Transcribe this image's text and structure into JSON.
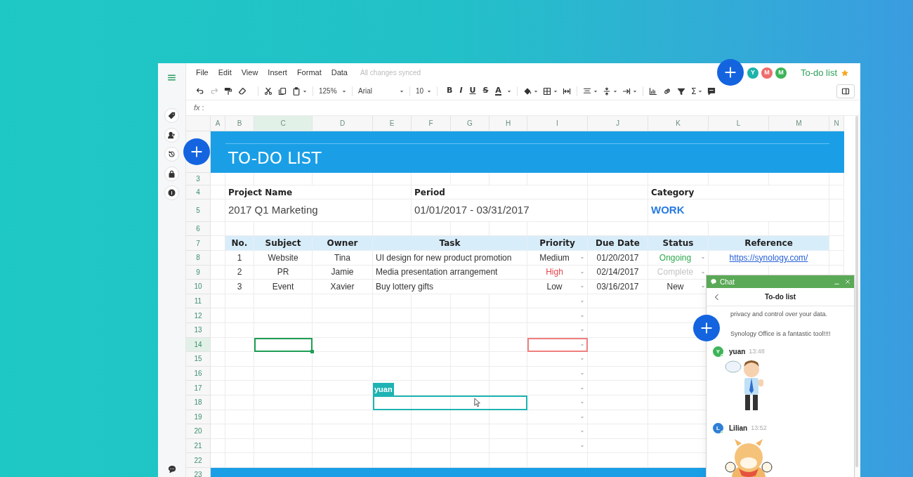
{
  "menu": [
    "File",
    "Edit",
    "View",
    "Insert",
    "Format",
    "Data"
  ],
  "sync_status": "All changes synced",
  "collaborators": [
    {
      "initial": "Y",
      "color": "#1db3aa"
    },
    {
      "initial": "M",
      "color": "#ef6c6c"
    },
    {
      "initial": "M",
      "color": "#3db45a"
    }
  ],
  "document": {
    "title": "To-do list",
    "starred": true
  },
  "toolbar": {
    "zoom": "125%",
    "font": "Arial",
    "font_size": "10",
    "text_styles": [
      {
        "glyph": "B",
        "kind": "bold"
      },
      {
        "glyph": "I",
        "kind": "italic"
      },
      {
        "glyph": "U",
        "kind": "underline"
      },
      {
        "glyph": "S",
        "kind": "strike"
      },
      {
        "glyph": "A",
        "kind": "color"
      }
    ],
    "sum": "Σ"
  },
  "formula_bar": {
    "label": "*fx* :"
  },
  "columns": [
    {
      "label": "A",
      "selected": false
    },
    {
      "label": "B",
      "selected": false
    },
    {
      "label": "C",
      "selected": true
    },
    {
      "label": "D",
      "selected": false
    },
    {
      "label": "E",
      "selected": false
    },
    {
      "label": "F",
      "selected": false
    },
    {
      "label": "G",
      "selected": false
    },
    {
      "label": "H",
      "selected": false
    },
    {
      "label": "I",
      "selected": false
    },
    {
      "label": "J",
      "selected": false
    },
    {
      "label": "K",
      "selected": false
    },
    {
      "label": "L",
      "selected": false
    },
    {
      "label": "M",
      "selected": false
    },
    {
      "label": "N",
      "selected": false
    }
  ],
  "row_numbers": [
    {
      "label": "3",
      "selected": false
    },
    {
      "label": "4",
      "selected": false
    },
    {
      "label": "5",
      "selected": false
    },
    {
      "label": "6",
      "selected": false
    },
    {
      "label": "7",
      "selected": false
    },
    {
      "label": "8",
      "selected": false
    },
    {
      "label": "9",
      "selected": false
    },
    {
      "label": "10",
      "selected": false
    },
    {
      "label": "11",
      "selected": false
    },
    {
      "label": "12",
      "selected": false
    },
    {
      "label": "13",
      "selected": false
    },
    {
      "label": "14",
      "selected": true
    },
    {
      "label": "15",
      "selected": false
    },
    {
      "label": "16",
      "selected": false
    },
    {
      "label": "17",
      "selected": false
    },
    {
      "label": "18",
      "selected": false
    },
    {
      "label": "19",
      "selected": false
    },
    {
      "label": "20",
      "selected": false
    },
    {
      "label": "21",
      "selected": false
    },
    {
      "label": "22",
      "selected": false
    },
    {
      "label": "23",
      "selected": false
    }
  ],
  "sheet": {
    "title": "TO-DO LIST",
    "fields": [
      {
        "label": "Project Name",
        "value": "2017 Q1 Marketing",
        "kind": "plain"
      },
      {
        "label": "Period",
        "value": "01/01/2017 - 03/31/2017",
        "kind": "plain"
      },
      {
        "label": "Category",
        "value": "WORK",
        "kind": "tag"
      }
    ],
    "table": {
      "headers": [
        "No.",
        "Subject",
        "Owner",
        "Task",
        "Priority",
        "Due Date",
        "Status",
        "Reference"
      ],
      "rows": [
        {
          "no": "1",
          "subject": "Website",
          "owner": "Tina",
          "task": "UI design for new product promotion",
          "priority": {
            "text": "Medium",
            "color": "#333333"
          },
          "due": "01/20/2017",
          "status": {
            "text": "Ongoing",
            "color": "#2eaa4e"
          },
          "reference": "https://synology.com/"
        },
        {
          "no": "2",
          "subject": "PR",
          "owner": "Jamie",
          "task": "Media presentation arrangement",
          "priority": {
            "text": "High",
            "color": "#e8474c"
          },
          "due": "02/14/2017",
          "status": {
            "text": "Complete",
            "color": "#c4c4c4"
          }
        },
        {
          "no": "3",
          "subject": "Event",
          "owner": "Xavier",
          "task": "Buy lottery gifts",
          "priority": {
            "text": "Low",
            "color": "#333333"
          },
          "due": "03/16/2017",
          "status": {
            "text": "New",
            "color": "#333333"
          }
        }
      ]
    },
    "remote_cursor": {
      "user": "yuan",
      "color": "#1fb3b3"
    }
  },
  "chat": {
    "title": "Chat",
    "conversation": "To-do list",
    "messages": [
      {
        "kind": "text",
        "text": "privacy and control over your data."
      },
      {
        "kind": "text",
        "text": "Synology Office is a fantastic tool!!!!"
      },
      {
        "kind": "sticker",
        "author": "yuan",
        "initial": "Y",
        "color": "#3db45a",
        "time": "13:48"
      },
      {
        "kind": "sticker",
        "author": "Lilian",
        "initial": "L",
        "color": "#2f7fd6",
        "time": "13:52"
      }
    ]
  }
}
